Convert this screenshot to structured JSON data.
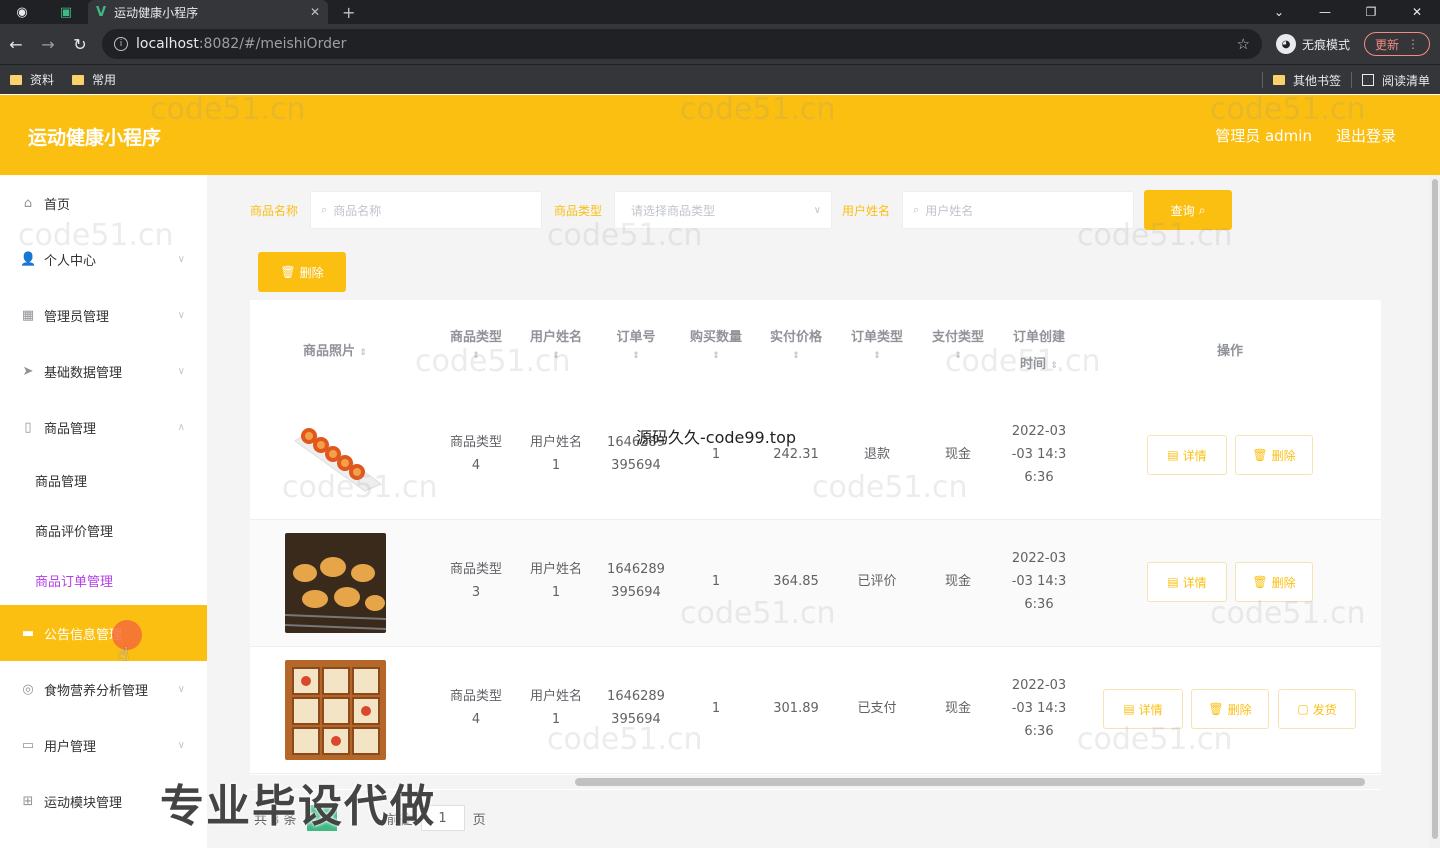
{
  "browser": {
    "tab_title": "运动健康小程序",
    "url_host": "localhost",
    "url_path": ":8082/#/meishiOrder",
    "incognito_label": "无痕模式",
    "update_label": "更新",
    "bookmarks": [
      "资料",
      "常用"
    ],
    "bookmarks_right": [
      "其他书签",
      "阅读清单"
    ]
  },
  "header": {
    "title": "运动健康小程序",
    "user": "管理员 admin",
    "logout": "退出登录"
  },
  "sidebar": {
    "items": [
      {
        "label": "首页",
        "icon": "home-icon"
      },
      {
        "label": "个人中心",
        "icon": "user-icon"
      },
      {
        "label": "管理员管理",
        "icon": "grid-icon"
      },
      {
        "label": "基础数据管理",
        "icon": "send-icon"
      },
      {
        "label": "商品管理",
        "icon": "phone-icon"
      },
      {
        "label": "公告信息管理",
        "icon": "folder-icon"
      },
      {
        "label": "食物营养分析管理",
        "icon": "compass-icon"
      },
      {
        "label": "用户管理",
        "icon": "keyboard-icon"
      },
      {
        "label": "运动模块管理",
        "icon": "apps-icon"
      }
    ],
    "sub_items": [
      "商品管理",
      "商品评价管理",
      "商品订单管理"
    ]
  },
  "search": {
    "name_label": "商品名称",
    "name_placeholder": "商品名称",
    "type_label": "商品类型",
    "type_placeholder": "请选择商品类型",
    "user_label": "用户姓名",
    "user_placeholder": "用户姓名",
    "query_button": "查询",
    "delete_button": "删除"
  },
  "table": {
    "headers": {
      "photo": "商品照片",
      "type": "商品类型",
      "user": "用户姓名",
      "order_no": "订单号",
      "qty": "购买数量",
      "price": "实付价格",
      "order_type": "订单类型",
      "pay_type": "支付类型",
      "created_1": "订单创建",
      "created_2": "时间",
      "ops": "操作"
    },
    "rows": [
      {
        "type_1": "商品类型",
        "type_2": "4",
        "user_1": "用户姓名",
        "user_2": "1",
        "order_1": "1646289",
        "order_2": "395694",
        "qty": "1",
        "price": "242.31",
        "order_type": "退款",
        "pay_type": "现金",
        "time_1": "2022-03",
        "time_2": "-03 14:3",
        "time_3": "6:36",
        "ops": [
          "详情",
          "删除"
        ]
      },
      {
        "type_1": "商品类型",
        "type_2": "3",
        "user_1": "用户姓名",
        "user_2": "1",
        "order_1": "1646289",
        "order_2": "395694",
        "qty": "1",
        "price": "364.85",
        "order_type": "已评价",
        "pay_type": "现金",
        "time_1": "2022-03",
        "time_2": "-03 14:3",
        "time_3": "6:36",
        "ops": [
          "详情",
          "删除"
        ]
      },
      {
        "type_1": "商品类型",
        "type_2": "4",
        "user_1": "用户姓名",
        "user_2": "1",
        "order_1": "1646289",
        "order_2": "395694",
        "qty": "1",
        "price": "301.89",
        "order_type": "已支付",
        "pay_type": "现金",
        "time_1": "2022-03",
        "time_2": "-03 14:3",
        "time_3": "6:36",
        "ops": [
          "详情",
          "删除",
          "发货"
        ]
      }
    ]
  },
  "pager": {
    "total": "共 3 条",
    "current": "1",
    "goto": "前往",
    "page_input": "1",
    "page_unit": "页"
  },
  "overlays": {
    "source_text": "源码久久-code99.top",
    "promo": "专业毕设代做",
    "watermark": "code51.cn"
  },
  "colors": {
    "accent": "#fbbf12",
    "active_sub": "#b43ee8"
  }
}
